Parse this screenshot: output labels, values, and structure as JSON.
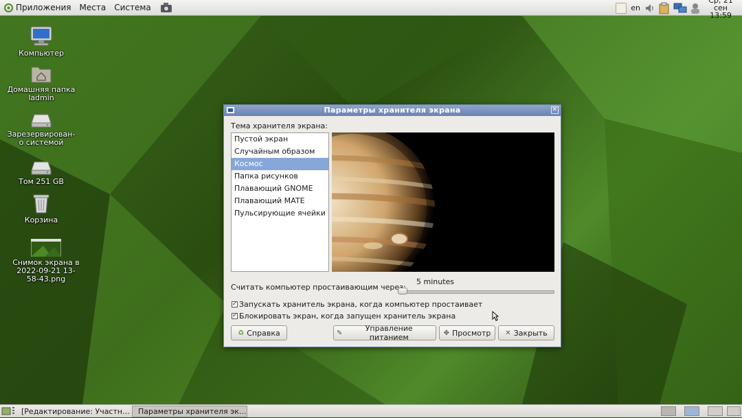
{
  "top_panel": {
    "menus": [
      "Приложения",
      "Места",
      "Система"
    ],
    "keyboard_layout": "en",
    "clock_line1": "Ср, 21 сен",
    "clock_line2": "13:59"
  },
  "desktop_icons": [
    {
      "label": "Компьютер",
      "icon": "computer-icon"
    },
    {
      "label": "Домашняя папка ladmin",
      "icon": "home-folder-icon"
    },
    {
      "label": "Зарезервирован-о системой",
      "icon": "drive-icon"
    },
    {
      "label": "Том 251 GB",
      "icon": "drive-icon"
    },
    {
      "label": "Корзина",
      "icon": "trash-icon"
    },
    {
      "label": "Снимок экрана в 2022-09-21 13-58-43.png",
      "icon": "image-thumbnail-icon"
    }
  ],
  "dialog": {
    "title": "Параметры хранителя экрана",
    "theme_label": "Тема хранителя экрана:",
    "themes": [
      "Пустой экран",
      "Случайным образом",
      "Космос",
      "Папка рисунков",
      "Плавающий GNOME",
      "Плавающий MATE",
      "Пульсирующие ячейки"
    ],
    "selected_theme": "Космос",
    "idle_label": "Считать компьютер простаивающим через:",
    "idle_value_text": "5 minutes",
    "idle_slider_value": 5,
    "checkbox_activate": {
      "label": "Запускать хранитель экрана, когда компьютер простаивает",
      "checked": true
    },
    "checkbox_lock": {
      "label": "Блокировать экран, когда запущен хранитель экрана",
      "checked": true
    },
    "buttons": {
      "help": "Справка",
      "power": "Управление питанием",
      "preview": "Просмотр",
      "close": "Закрыть"
    }
  },
  "taskbar": {
    "tasks": [
      {
        "label": "[Редактирование: Участн...",
        "active": false
      },
      {
        "label": "Параметры хранителя эк...",
        "active": true
      }
    ]
  },
  "colors": {
    "selection": "#86a8d9",
    "titlebar": "#6b83b3",
    "desktop": "#3b6b1c"
  }
}
